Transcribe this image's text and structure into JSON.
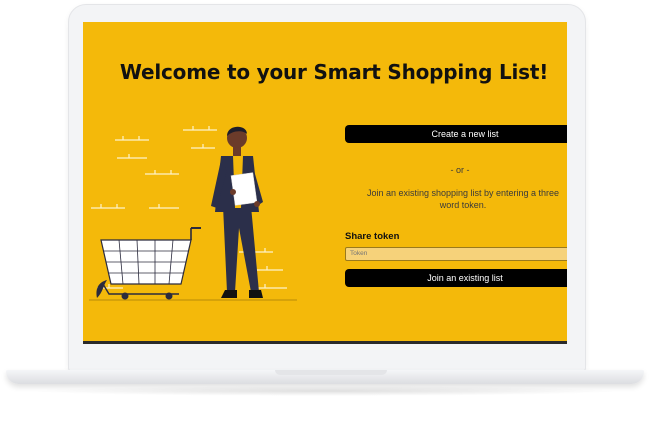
{
  "app": {
    "title": "Welcome to your Smart Shopping List!"
  },
  "actions": {
    "create_label": "Create a new list",
    "or_label": "- or -",
    "join_description_line1": "Join an existing shopping list by entering a three",
    "join_description_line2": "word token.",
    "share_token_label": "Share token",
    "token_placeholder": "Token",
    "join_label": "Join an existing list"
  },
  "colors": {
    "background": "#f4b90a",
    "button": "#000000",
    "button_text": "#ffffff",
    "input_background": "#f6d27a"
  },
  "illustration": {
    "icon": "person-with-shopping-cart"
  }
}
